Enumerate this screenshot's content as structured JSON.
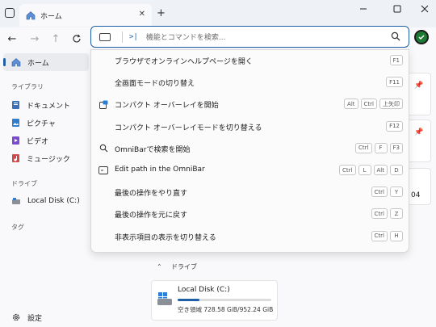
{
  "tab": {
    "title": "ホーム"
  },
  "omnibar": {
    "prompt": ">|",
    "placeholder": "機能とコマンドを検索..."
  },
  "sidebar": {
    "home": "ホーム",
    "library_heading": "ライブラリ",
    "library": [
      "ドキュメント",
      "ピクチャ",
      "ビデオ",
      "ミュージック"
    ],
    "drives_heading": "ドライブ",
    "drives": [
      "Local Disk (C:)"
    ],
    "tags_heading": "タグ",
    "settings": "設定"
  },
  "content": {
    "drives_section": "ドライブ",
    "drive_name": "Local Disk (C:)",
    "drive_free": "空き領域 728.58 GiB/952.24 GiB",
    "drive_used_fraction": 0.235,
    "peek_text": "04"
  },
  "commands": [
    {
      "label": "ブラウザでオンラインヘルプページを開く",
      "keys": [
        "F1"
      ],
      "icon": ""
    },
    {
      "label": "全画面モードの切り替え",
      "keys": [
        "F11"
      ],
      "icon": ""
    },
    {
      "label": "コンパクト オーバーレイを開始",
      "keys": [
        "Alt",
        "Ctrl",
        "上矢印"
      ],
      "icon": "compact-overlay-icon"
    },
    {
      "label": "コンパクト オーバーレイモードを切り替える",
      "keys": [
        "F12"
      ],
      "icon": ""
    },
    {
      "label": "OmniBarで検索を開始",
      "keys": [
        "Ctrl",
        "F",
        "F3"
      ],
      "icon": "search-icon"
    },
    {
      "label": "Edit path in the OmniBar",
      "keys": [
        "Ctrl",
        "L",
        "Alt",
        "D"
      ],
      "icon": "omnibar-path-icon"
    },
    {
      "label": "最後の操作をやり直す",
      "keys": [
        "Ctrl",
        "Y"
      ],
      "icon": ""
    },
    {
      "label": "最後の操作を元に戻す",
      "keys": [
        "Ctrl",
        "Z"
      ],
      "icon": ""
    },
    {
      "label": "非表示項目の表示を切り替える",
      "keys": [
        "Ctrl",
        "H"
      ],
      "icon": ""
    }
  ]
}
